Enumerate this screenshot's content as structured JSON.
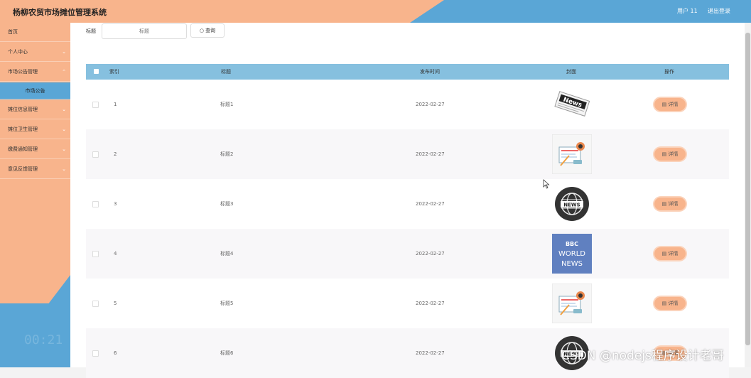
{
  "header": {
    "title": "杨柳农贸市场摊位管理系统",
    "user": "用户 11",
    "logout": "退出登录"
  },
  "sidebar": {
    "items": [
      {
        "label": "首页",
        "chevron": ""
      },
      {
        "label": "个人中心",
        "chevron": "⌄"
      },
      {
        "label": "市场公告管理",
        "chevron": "⌃"
      },
      {
        "label": "市场公告",
        "chevron": ""
      },
      {
        "label": "摊位信息管理",
        "chevron": "⌄"
      },
      {
        "label": "摊位卫生管理",
        "chevron": "⌄"
      },
      {
        "label": "缴费通知管理",
        "chevron": "⌄"
      },
      {
        "label": "意见反馈管理",
        "chevron": "⌄"
      }
    ],
    "clock": "00:21"
  },
  "search": {
    "label": "标题",
    "placeholder": "标题",
    "button": "查询",
    "button_icon": "○"
  },
  "table": {
    "columns": [
      "索引",
      "标题",
      "发布时间",
      "封面",
      "操作"
    ],
    "detail_label": "详情",
    "detail_icon": "▤",
    "rows": [
      {
        "index": "1",
        "title": "标题1",
        "date": "2022-02-27",
        "cover": "newspaper-icon"
      },
      {
        "index": "2",
        "title": "标题2",
        "date": "2022-02-27",
        "cover": "news-illustration-icon"
      },
      {
        "index": "3",
        "title": "标题3",
        "date": "2022-02-27",
        "cover": "news-globe-icon"
      },
      {
        "index": "4",
        "title": "标题4",
        "date": "2022-02-27",
        "cover": "bbc-world-news-icon",
        "cover_text": [
          "BBC",
          "WORLD",
          "NEWS"
        ]
      },
      {
        "index": "5",
        "title": "标题5",
        "date": "2022-02-27",
        "cover": "news-illustration-icon"
      },
      {
        "index": "6",
        "title": "标题6",
        "date": "2022-02-27",
        "cover": "news-globe-icon"
      }
    ]
  },
  "watermark": "CSDN @nodejs程序设计老哥",
  "colors": {
    "peach": "#f8b48c",
    "blue": "#5aa6d6",
    "table_header": "#86c0df"
  }
}
